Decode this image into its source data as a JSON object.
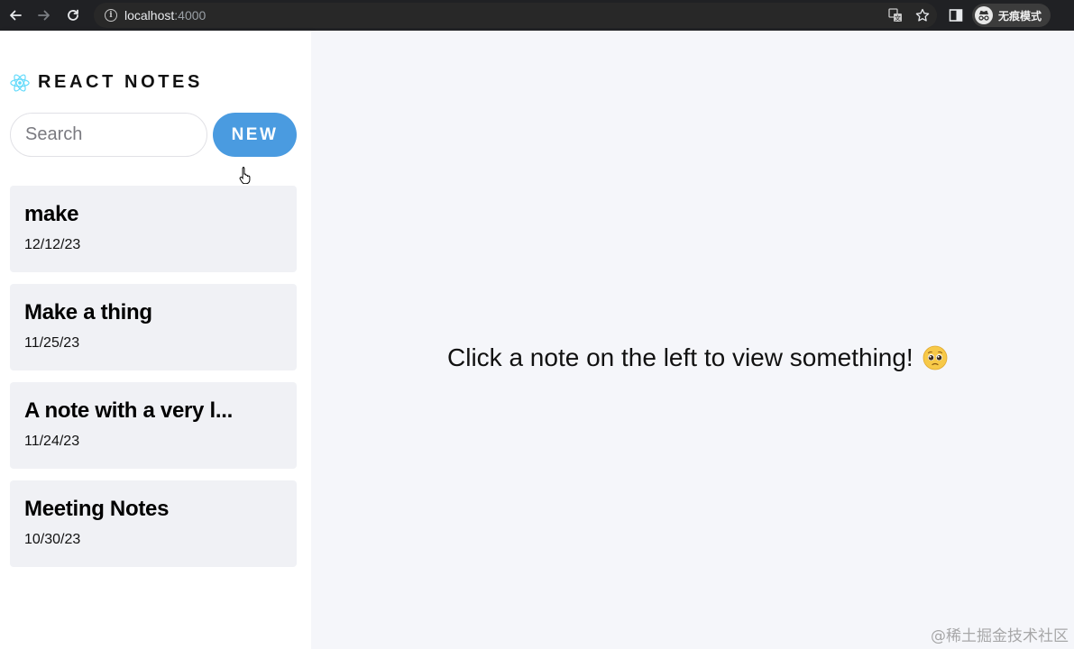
{
  "browser": {
    "url_host": "localhost",
    "url_port": ":4000",
    "profile_label": "无痕模式"
  },
  "sidebar": {
    "brand_title": "REACT NOTES",
    "search_placeholder": "Search",
    "new_button_label": "NEW",
    "notes": [
      {
        "title": "make",
        "date": "12/12/23"
      },
      {
        "title": "Make a thing",
        "date": "11/25/23"
      },
      {
        "title": "A note with a very l...",
        "date": "11/24/23"
      },
      {
        "title": "Meeting Notes",
        "date": "10/30/23"
      }
    ]
  },
  "main": {
    "empty_message": "Click a note on the left to view something!",
    "emoji_icon": "pleading-face-icon"
  },
  "watermark": "@稀土掘金技术社区",
  "colors": {
    "accent": "#4a9be0",
    "react_logo": "#61dafb",
    "card_bg": "#f0f1f5",
    "main_bg": "#f5f6fa"
  }
}
